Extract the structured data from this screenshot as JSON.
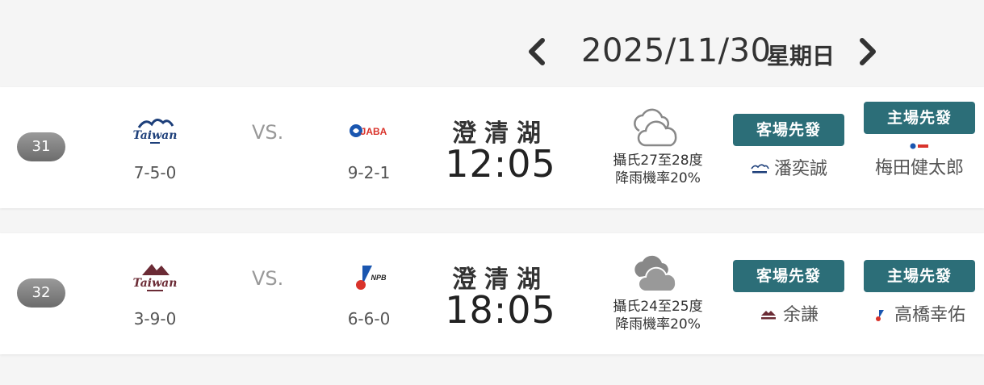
{
  "header": {
    "date": "2025/11/30",
    "weekday": "星期日",
    "prev_icon": "chevron-left-icon",
    "next_icon": "chevron-right-icon"
  },
  "games": [
    {
      "game_no": "31",
      "away": {
        "logo_icon": "taiwan-wave-logo",
        "logo_text": "Taiwan",
        "record": "7-5-0"
      },
      "vs": "VS.",
      "home": {
        "logo_icon": "jaba-logo",
        "logo_text": "JABA",
        "record": "9-2-1"
      },
      "venue": "澄清湖",
      "time": "12:05",
      "weather": {
        "icon": "cloud-outline-icon",
        "temp": "攝氏27至28度",
        "rain": "降雨機率20%"
      },
      "away_starter": {
        "label": "客場先發",
        "pitcher": "潘奕誠"
      },
      "home_starter": {
        "label": "主場先發",
        "pitcher": "梅田健太郎"
      }
    },
    {
      "game_no": "32",
      "away": {
        "logo_icon": "taiwan-mountain-logo",
        "logo_text": "Taiwan",
        "record": "3-9-0"
      },
      "vs": "VS.",
      "home": {
        "logo_icon": "npb-logo",
        "logo_text": "NPB",
        "record": "6-6-0"
      },
      "venue": "澄清湖",
      "time": "18:05",
      "weather": {
        "icon": "cloud-filled-icon",
        "temp": "攝氏24至25度",
        "rain": "降雨機率20%"
      },
      "away_starter": {
        "label": "客場先發",
        "pitcher": "余謙"
      },
      "home_starter": {
        "label": "主場先發",
        "pitcher": "高橋幸佑"
      }
    }
  ],
  "colors": {
    "accent": "#2c6e78",
    "badge": "#7a7a7a",
    "background": "#f5f5f5"
  }
}
